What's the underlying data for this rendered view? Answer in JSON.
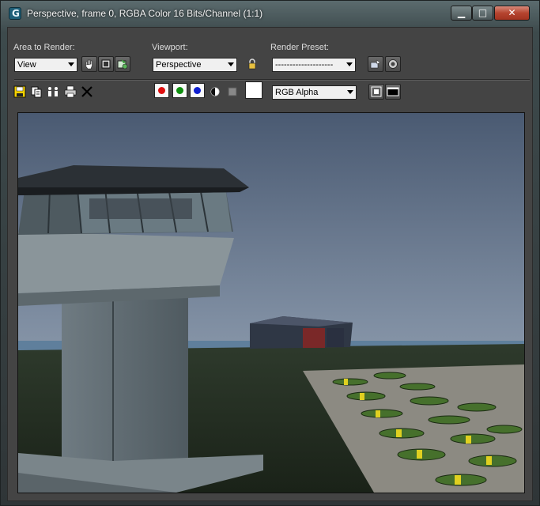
{
  "window": {
    "title": "Perspective, frame 0, RGBA Color 16 Bits/Channel (1:1)",
    "app_icon_glyph": "G",
    "minimize_glyph": "▁",
    "maximize_glyph": "□",
    "close_glyph": "✕"
  },
  "toolbar": {
    "area_label": "Area to Render:",
    "area_value": "View",
    "viewport_label": "Viewport:",
    "viewport_value": "Perspective",
    "preset_label": "Render Preset:",
    "preset_value": "--------------------",
    "channel_value": "RGB Alpha"
  },
  "colors": {
    "red_channel": "#e01010",
    "green_channel": "#109010",
    "blue_channel": "#1020d0",
    "swatch": "#ffffff"
  },
  "icons": [
    "save-icon",
    "copy-icon",
    "clone-icon",
    "print-icon",
    "clear-icon",
    "mono-icon",
    "alpha-icon",
    "pan-icon",
    "region-icon",
    "render-icon",
    "lock-icon",
    "env-icon",
    "settings-icon",
    "display-a-icon",
    "display-b-icon"
  ]
}
